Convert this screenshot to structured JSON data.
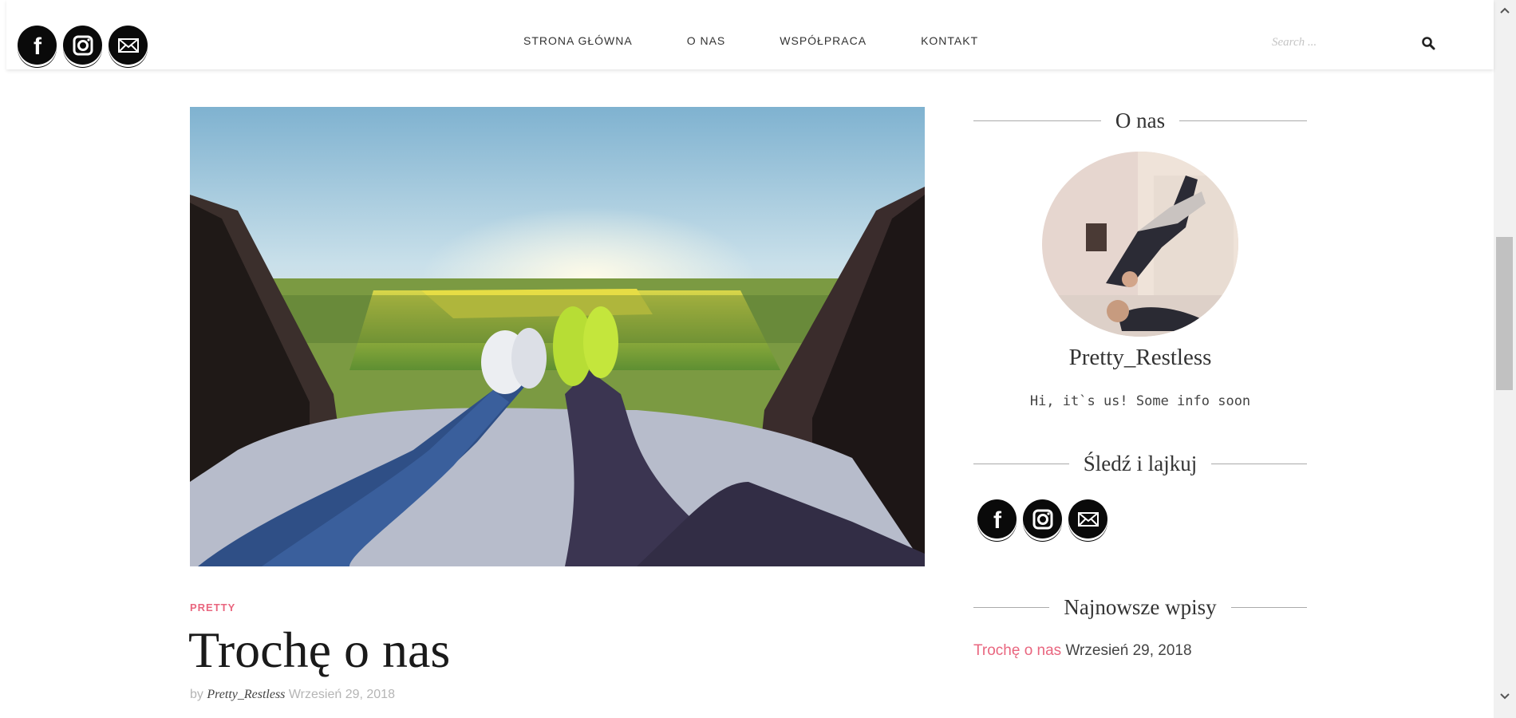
{
  "header": {
    "social": [
      {
        "name": "facebook-icon",
        "label": "f"
      },
      {
        "name": "instagram-icon"
      },
      {
        "name": "mail-icon"
      }
    ],
    "nav": [
      "STRONA GŁÓWNA",
      "O NAS",
      "WSPÓŁPRACA",
      "KONTAKT"
    ],
    "search_placeholder": "Search ..."
  },
  "post": {
    "category": "PRETTY",
    "title": "Trochę o nas",
    "by": "by",
    "author": "Pretty_Restless",
    "date": "Wrzesień 29, 2018"
  },
  "sidebar": {
    "about_title": "O nas",
    "profile_name": "Pretty_Restless",
    "profile_bio": "Hi, it`s us! Some info soon",
    "follow_title": "Śledź i lajkuj",
    "recent_title": "Najnowsze wpisy",
    "recent_posts": [
      {
        "title": "Trochę o nas",
        "date": "Wrzesień 29, 2018"
      }
    ]
  },
  "colors": {
    "accent": "#e9667f",
    "icon_bg": "#0a0a0a"
  }
}
